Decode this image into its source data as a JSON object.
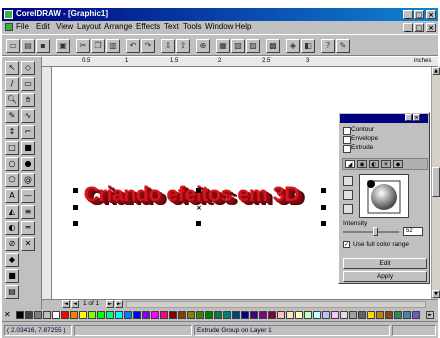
{
  "window": {
    "title": "CorelDRAW - [Graphic1]"
  },
  "menu": [
    "File",
    "Edit",
    "View",
    "Layout",
    "Arrange",
    "Effects",
    "Text",
    "Tools",
    "Window",
    "Help"
  ],
  "canvas": {
    "art_text": "Criando efeitos em 3D"
  },
  "docker": {
    "items": [
      "Contour",
      "Envelope",
      "Extrude"
    ],
    "intensity_label": "Intensity",
    "intensity_value": "52",
    "checkbox_label": "Use full color range",
    "edit_button": "Edit",
    "apply_button": "Apply"
  },
  "pagenav": {
    "page_label": "1 of 1"
  },
  "status": {
    "coords": "( 2.03416, 7.87255 )",
    "message": "Extrude Group on Layer 1"
  },
  "colors": {
    "title_blue": "#000080",
    "art_red": "#d8141c",
    "chrome_gray": "#c0c0c0"
  }
}
